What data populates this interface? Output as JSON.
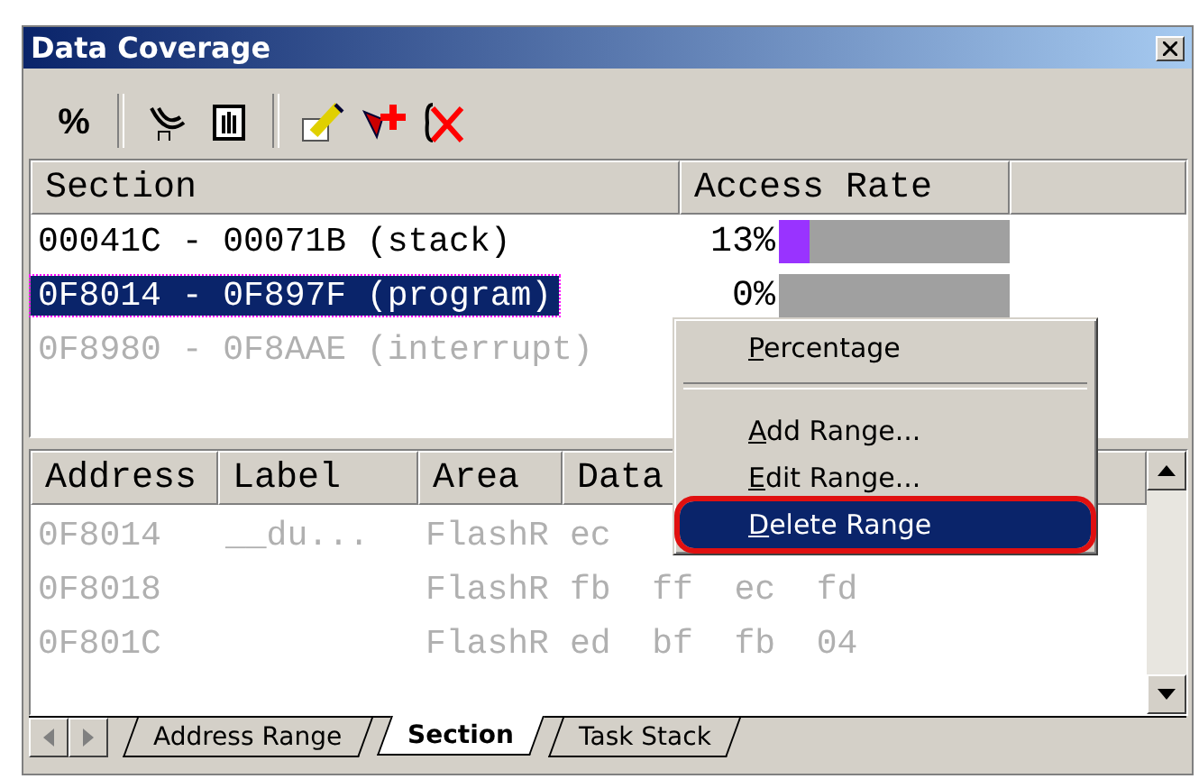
{
  "window": {
    "title": "Data Coverage"
  },
  "toolbar": {
    "percent_button": "%"
  },
  "section_table": {
    "columns": [
      "Section",
      "Access Rate"
    ],
    "rows": [
      {
        "section": "00041C - 00071B (stack)",
        "rate": "13%",
        "level": 0.13,
        "selected": false,
        "disabled": false
      },
      {
        "section": "0F8014 - 0F897F (program)",
        "rate": "0%",
        "level": 0,
        "selected": true,
        "disabled": false
      },
      {
        "section": "0F8980 - 0F8AAE (interrupt)",
        "selected": false,
        "disabled": true
      }
    ]
  },
  "data_table": {
    "columns": [
      "Address",
      "Label",
      "Area",
      "Data"
    ],
    "rows": [
      {
        "address": "0F8014",
        "label": "__du...",
        "area": "FlashR",
        "data": "ec",
        "disabled": true
      },
      {
        "address": "0F8018",
        "label": "",
        "area": "FlashR",
        "data": "fb  ff  ec  fd",
        "disabled": true
      },
      {
        "address": "0F801C",
        "label": "",
        "area": "FlashR",
        "data": "ed  bf  fb  04",
        "disabled": true
      }
    ]
  },
  "tabs": [
    {
      "label": "Address Range",
      "selected": false
    },
    {
      "label": "Section",
      "selected": true
    },
    {
      "label": "Task Stack",
      "selected": false
    }
  ],
  "context_menu": {
    "items": [
      {
        "kind": "item",
        "label": "Percentage",
        "selected": false
      },
      {
        "kind": "separator"
      },
      {
        "kind": "item",
        "label": "Add Range...",
        "selected": false
      },
      {
        "kind": "item",
        "label": "Edit Range...",
        "selected": false
      },
      {
        "kind": "item",
        "label": "Delete Range",
        "selected": true,
        "circled": true
      }
    ]
  }
}
